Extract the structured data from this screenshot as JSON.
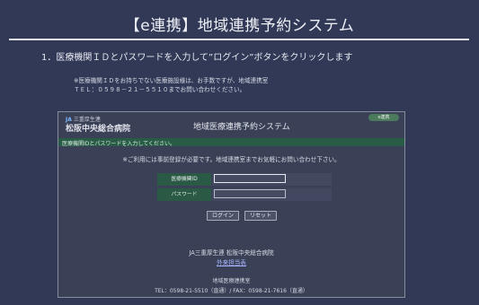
{
  "page_title": "【e連携】地域連携予約システム",
  "step_text": "1．医療機関ＩＤとパスワードを入力して”ログイン”ボタンをクリックします",
  "note_line1": "※医療機関ＩＤをお持ちでない医療施設様は、お手数ですが、地域連携室",
  "note_line2": "ＴＥＬ：０５９８－２１－５５１０までお問い合わせください。",
  "screenshot": {
    "logo_small": "三重厚生連",
    "logo_mark": "JA",
    "logo_main": "松阪中央総合病院",
    "system_title": "地域医療連携予約システム",
    "badge": "e連携",
    "bar_text": "医療機関IDとパスワードを入力してください。",
    "notice": "※ご利用には事前登録が必要です。地域連携室までお気軽にお問い合わせ下さい。",
    "id_label": "医療機関ID",
    "id_value": "",
    "password_label": "パスワード",
    "password_value": "",
    "login_label": "ログイン",
    "reset_label": "リセット",
    "hospital_name": "JA三重厚生連 松阪中央総合病院",
    "outpatient_link": "外来担当表",
    "office": "地域医療連携室",
    "contact": "TEL：0598-21-5510（直通）/ FAX：0598-21-7616（直通）"
  }
}
